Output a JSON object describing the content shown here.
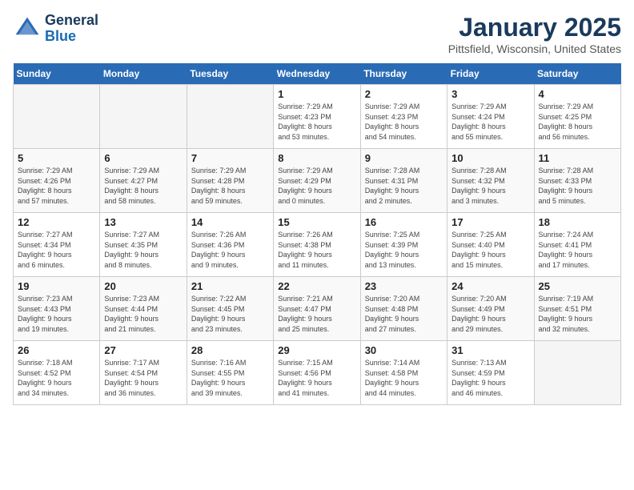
{
  "header": {
    "logo_line1": "General",
    "logo_line2": "Blue",
    "month": "January 2025",
    "location": "Pittsfield, Wisconsin, United States"
  },
  "days_of_week": [
    "Sunday",
    "Monday",
    "Tuesday",
    "Wednesday",
    "Thursday",
    "Friday",
    "Saturday"
  ],
  "weeks": [
    [
      {
        "day": "",
        "info": ""
      },
      {
        "day": "",
        "info": ""
      },
      {
        "day": "",
        "info": ""
      },
      {
        "day": "1",
        "info": "Sunrise: 7:29 AM\nSunset: 4:23 PM\nDaylight: 8 hours\nand 53 minutes."
      },
      {
        "day": "2",
        "info": "Sunrise: 7:29 AM\nSunset: 4:23 PM\nDaylight: 8 hours\nand 54 minutes."
      },
      {
        "day": "3",
        "info": "Sunrise: 7:29 AM\nSunset: 4:24 PM\nDaylight: 8 hours\nand 55 minutes."
      },
      {
        "day": "4",
        "info": "Sunrise: 7:29 AM\nSunset: 4:25 PM\nDaylight: 8 hours\nand 56 minutes."
      }
    ],
    [
      {
        "day": "5",
        "info": "Sunrise: 7:29 AM\nSunset: 4:26 PM\nDaylight: 8 hours\nand 57 minutes."
      },
      {
        "day": "6",
        "info": "Sunrise: 7:29 AM\nSunset: 4:27 PM\nDaylight: 8 hours\nand 58 minutes."
      },
      {
        "day": "7",
        "info": "Sunrise: 7:29 AM\nSunset: 4:28 PM\nDaylight: 8 hours\nand 59 minutes."
      },
      {
        "day": "8",
        "info": "Sunrise: 7:29 AM\nSunset: 4:29 PM\nDaylight: 9 hours\nand 0 minutes."
      },
      {
        "day": "9",
        "info": "Sunrise: 7:28 AM\nSunset: 4:31 PM\nDaylight: 9 hours\nand 2 minutes."
      },
      {
        "day": "10",
        "info": "Sunrise: 7:28 AM\nSunset: 4:32 PM\nDaylight: 9 hours\nand 3 minutes."
      },
      {
        "day": "11",
        "info": "Sunrise: 7:28 AM\nSunset: 4:33 PM\nDaylight: 9 hours\nand 5 minutes."
      }
    ],
    [
      {
        "day": "12",
        "info": "Sunrise: 7:27 AM\nSunset: 4:34 PM\nDaylight: 9 hours\nand 6 minutes."
      },
      {
        "day": "13",
        "info": "Sunrise: 7:27 AM\nSunset: 4:35 PM\nDaylight: 9 hours\nand 8 minutes."
      },
      {
        "day": "14",
        "info": "Sunrise: 7:26 AM\nSunset: 4:36 PM\nDaylight: 9 hours\nand 9 minutes."
      },
      {
        "day": "15",
        "info": "Sunrise: 7:26 AM\nSunset: 4:38 PM\nDaylight: 9 hours\nand 11 minutes."
      },
      {
        "day": "16",
        "info": "Sunrise: 7:25 AM\nSunset: 4:39 PM\nDaylight: 9 hours\nand 13 minutes."
      },
      {
        "day": "17",
        "info": "Sunrise: 7:25 AM\nSunset: 4:40 PM\nDaylight: 9 hours\nand 15 minutes."
      },
      {
        "day": "18",
        "info": "Sunrise: 7:24 AM\nSunset: 4:41 PM\nDaylight: 9 hours\nand 17 minutes."
      }
    ],
    [
      {
        "day": "19",
        "info": "Sunrise: 7:23 AM\nSunset: 4:43 PM\nDaylight: 9 hours\nand 19 minutes."
      },
      {
        "day": "20",
        "info": "Sunrise: 7:23 AM\nSunset: 4:44 PM\nDaylight: 9 hours\nand 21 minutes."
      },
      {
        "day": "21",
        "info": "Sunrise: 7:22 AM\nSunset: 4:45 PM\nDaylight: 9 hours\nand 23 minutes."
      },
      {
        "day": "22",
        "info": "Sunrise: 7:21 AM\nSunset: 4:47 PM\nDaylight: 9 hours\nand 25 minutes."
      },
      {
        "day": "23",
        "info": "Sunrise: 7:20 AM\nSunset: 4:48 PM\nDaylight: 9 hours\nand 27 minutes."
      },
      {
        "day": "24",
        "info": "Sunrise: 7:20 AM\nSunset: 4:49 PM\nDaylight: 9 hours\nand 29 minutes."
      },
      {
        "day": "25",
        "info": "Sunrise: 7:19 AM\nSunset: 4:51 PM\nDaylight: 9 hours\nand 32 minutes."
      }
    ],
    [
      {
        "day": "26",
        "info": "Sunrise: 7:18 AM\nSunset: 4:52 PM\nDaylight: 9 hours\nand 34 minutes."
      },
      {
        "day": "27",
        "info": "Sunrise: 7:17 AM\nSunset: 4:54 PM\nDaylight: 9 hours\nand 36 minutes."
      },
      {
        "day": "28",
        "info": "Sunrise: 7:16 AM\nSunset: 4:55 PM\nDaylight: 9 hours\nand 39 minutes."
      },
      {
        "day": "29",
        "info": "Sunrise: 7:15 AM\nSunset: 4:56 PM\nDaylight: 9 hours\nand 41 minutes."
      },
      {
        "day": "30",
        "info": "Sunrise: 7:14 AM\nSunset: 4:58 PM\nDaylight: 9 hours\nand 44 minutes."
      },
      {
        "day": "31",
        "info": "Sunrise: 7:13 AM\nSunset: 4:59 PM\nDaylight: 9 hours\nand 46 minutes."
      },
      {
        "day": "",
        "info": ""
      }
    ]
  ]
}
